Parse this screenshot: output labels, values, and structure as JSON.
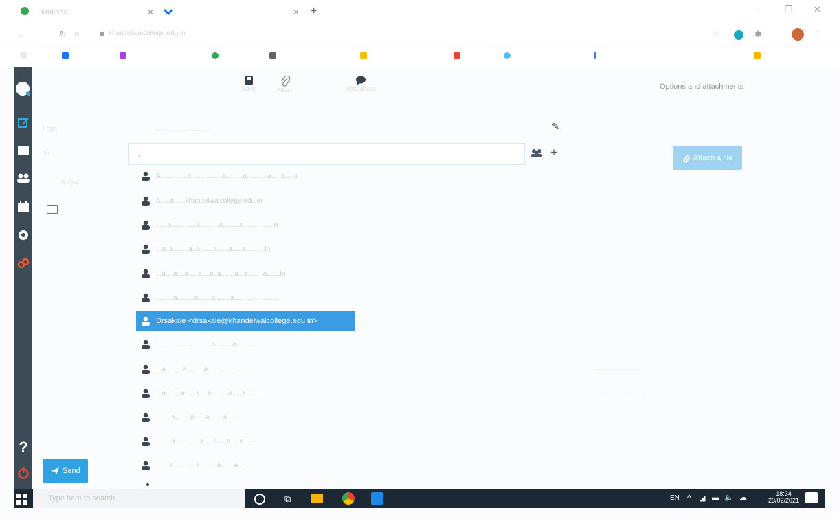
{
  "browser": {
    "tabs": [
      {
        "title": "Mailbox"
      },
      {
        "title": ""
      }
    ],
    "new_tab_symbol": "+",
    "url": "khandelwalcollege.edu.in",
    "window_controls": [
      "–",
      "❐",
      "✕"
    ],
    "bookmark_colors": [
      "#1a73e8",
      "#a142f4",
      "#34a853",
      "#5f6368",
      "#fbbc04",
      "#ea4335",
      "#5bb9f0",
      "#3b78e7",
      "#f4b400"
    ]
  },
  "toolbar": {
    "save_icon": "save-icon",
    "attach_icon": "paperclip-icon",
    "response_icon": "chat-bubble-icon",
    "save_label": "Save",
    "attach_label": "Attach",
    "response_label": "Responses"
  },
  "options": {
    "title": "Options and attachments",
    "attach_button": "Attach a file"
  },
  "compose": {
    "from_label": "From",
    "to_label": "To",
    "subject_label": "Subject",
    "recipient_value": ",",
    "edit_icon": "pencil-icon",
    "addressbook_icon": "addressbook-icon",
    "add_icon": "+"
  },
  "suggestions": [
    {
      "text": "A..............a................a.........a...........a.....a....in",
      "selected": false
    },
    {
      "text": "A.....a......khandelwalcollege.edu.in",
      "selected": false
    },
    {
      "text": "......a.............a..........a.........a...............in",
      "selected": false
    },
    {
      "text": "...a..a........a..a.......a......a.....a..........in",
      "selected": false
    },
    {
      "text": "...a....a....a.....a....a..a.......a...a........a.......in",
      "selected": false
    },
    {
      "text": ".........a.........a.......a........a.......................",
      "selected": false
    },
    {
      "text": "Drsakale <drsakale@khandelwalcollege.edu.in>",
      "selected": true
    },
    {
      "text": ".............................a.........a..........",
      "selected": false
    },
    {
      "text": "...a.........a.........a....................",
      "selected": false
    },
    {
      "text": "...a........a......a....a.........a.....a.........",
      "selected": false
    },
    {
      "text": "........a........a......a.......a.......",
      "selected": false
    },
    {
      "text": "........a.............a.....a.....a.....a.......",
      "selected": false
    },
    {
      "text": ".......a............a.........a.......a........",
      "selected": false
    }
  ],
  "sidebar_icons": [
    "mail-logo-icon",
    "compose-icon",
    "mail-icon",
    "contacts-icon",
    "calendar-icon",
    "settings-icon",
    "plugins-icon",
    "help-icon",
    "logout-icon"
  ],
  "send_button": "Send",
  "faint_options": [
    "...........................",
    "...........................",
    "...........................",
    "..........................."
  ],
  "taskbar": {
    "search_placeholder": "Type here to search",
    "lang": "EN",
    "time": "18:34",
    "date": "23/02/2021"
  }
}
